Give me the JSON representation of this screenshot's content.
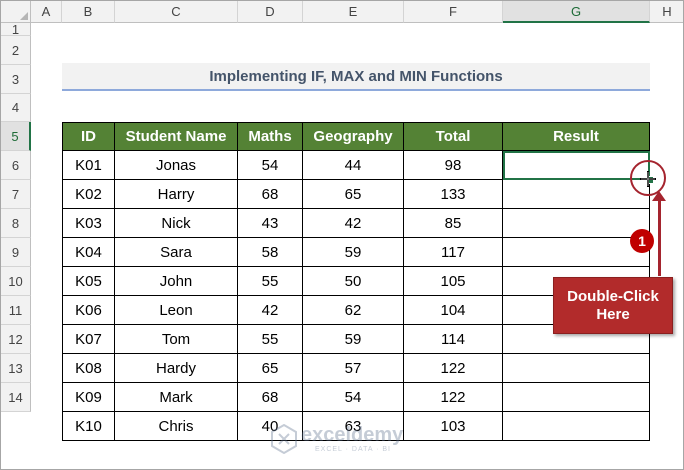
{
  "columns": [
    "A",
    "B",
    "C",
    "D",
    "E",
    "F",
    "G",
    "H"
  ],
  "rows": [
    "1",
    "2",
    "3",
    "4",
    "5",
    "6",
    "7",
    "8",
    "9",
    "10",
    "11",
    "12",
    "13",
    "14"
  ],
  "title": "Implementing IF, MAX and MIN Functions",
  "table": {
    "headers": [
      "ID",
      "Student Name",
      "Maths",
      "Geography",
      "Total",
      "Result"
    ],
    "rows": [
      [
        "K01",
        "Jonas",
        "54",
        "44",
        "98",
        ""
      ],
      [
        "K02",
        "Harry",
        "68",
        "65",
        "133",
        ""
      ],
      [
        "K03",
        "Nick",
        "43",
        "42",
        "85",
        ""
      ],
      [
        "K04",
        "Sara",
        "58",
        "59",
        "117",
        ""
      ],
      [
        "K05",
        "John",
        "55",
        "50",
        "105",
        ""
      ],
      [
        "K06",
        "Leon",
        "42",
        "62",
        "104",
        ""
      ],
      [
        "K07",
        "Tom",
        "55",
        "59",
        "114",
        ""
      ],
      [
        "K08",
        "Hardy",
        "65",
        "57",
        "122",
        ""
      ],
      [
        "K09",
        "Mark",
        "68",
        "54",
        "122",
        ""
      ],
      [
        "K10",
        "Chris",
        "40",
        "63",
        "103",
        ""
      ]
    ]
  },
  "annotation": {
    "step": "1",
    "callout_line1": "Double-Click",
    "callout_line2": "Here"
  },
  "watermark": {
    "name": "exceldemy",
    "tagline": "EXCEL · DATA · BI"
  },
  "selection": {
    "active_cell": "G5",
    "active_column": "G",
    "active_row": "5"
  },
  "colors": {
    "header_fill": "#548235",
    "title_text": "#44546a",
    "title_underline": "#8ea9db",
    "annotation_red": "#b22b2b",
    "selection_green": "#217346"
  }
}
